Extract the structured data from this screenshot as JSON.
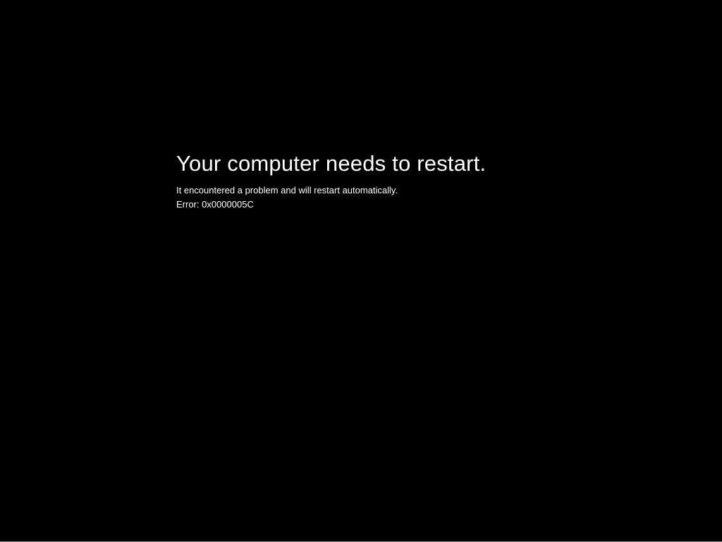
{
  "error_screen": {
    "heading": "Your computer needs to restart.",
    "subtext": "It encountered a problem and will restart automatically.",
    "error_code": "Error: 0x0000005C"
  }
}
